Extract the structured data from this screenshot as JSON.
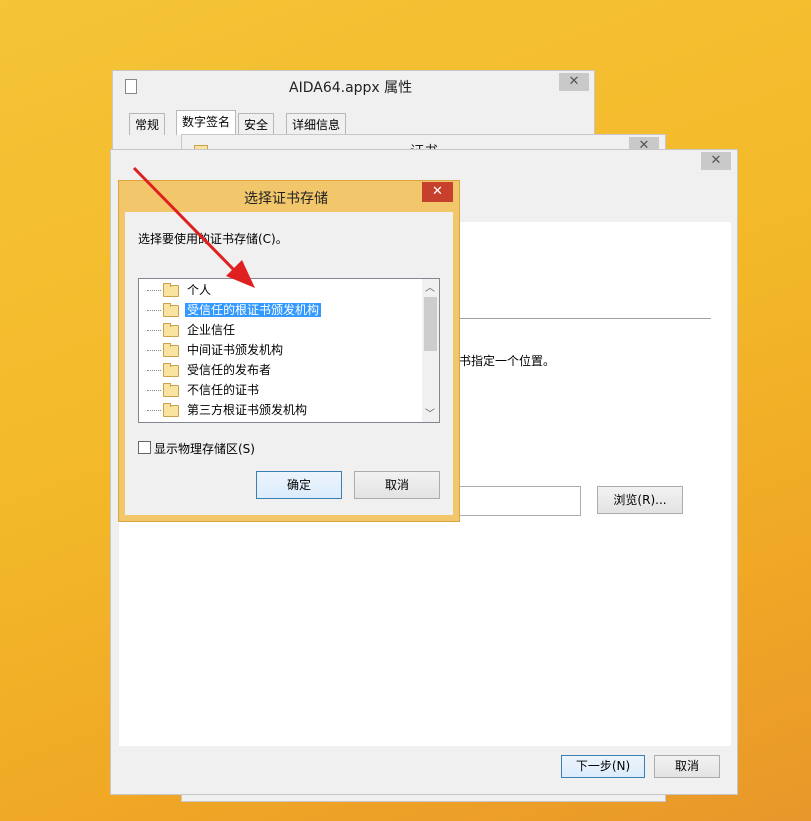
{
  "props_window": {
    "title": "AIDA64.appx 属性",
    "close": "✕",
    "tabs": [
      "常规",
      "数字签名",
      "安全",
      "详细信息"
    ]
  },
  "cert_window": {
    "title": "证书",
    "close": "✕"
  },
  "wizard_window": {
    "close": "✕",
    "partial_text": "书指定一个位置。",
    "browse_label": "浏览(R)...",
    "next_label": "下一步(N)",
    "cancel_label": "取消"
  },
  "store_dialog": {
    "title": "选择证书存储",
    "close": "✕",
    "prompt": "选择要使用的证书存储(C)。",
    "stores": [
      {
        "label": "个人",
        "selected": false
      },
      {
        "label": "受信任的根证书颁发机构",
        "selected": true
      },
      {
        "label": "企业信任",
        "selected": false
      },
      {
        "label": "中间证书颁发机构",
        "selected": false
      },
      {
        "label": "受信任的发布者",
        "selected": false
      },
      {
        "label": "不信任的证书",
        "selected": false
      },
      {
        "label": "第三方根证书颁发机构",
        "selected": false
      }
    ],
    "scroll_up": "︿",
    "scroll_down": "﹀",
    "show_physical_label": "显示物理存储区(S)",
    "show_physical_checked": false,
    "ok_label": "确定",
    "cancel_label": "取消"
  },
  "colors": {
    "accent_orange": "#f3b92a",
    "dialog_border": "#e8b95c",
    "close_red": "#c7402c",
    "selection_blue": "#3399ff",
    "arrow_red": "#e02020"
  }
}
